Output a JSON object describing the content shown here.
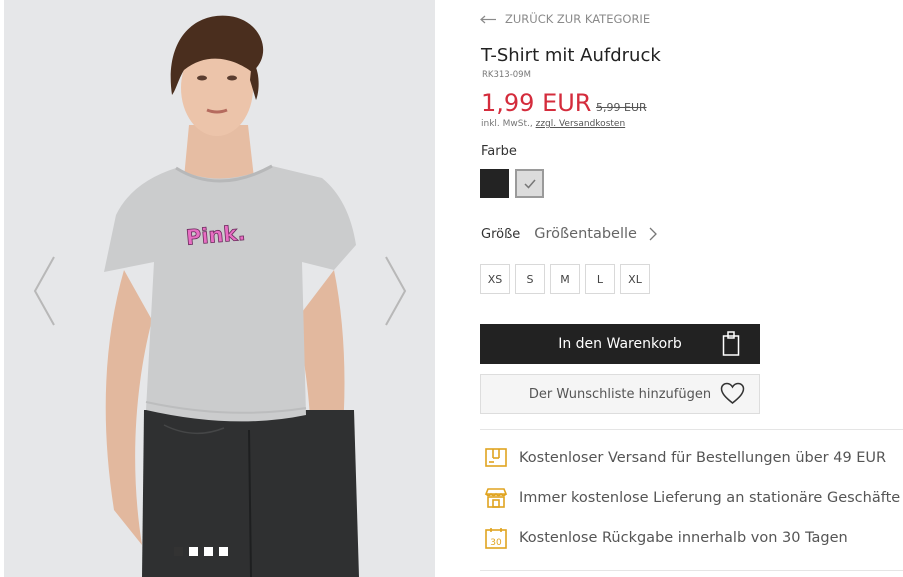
{
  "nav": {
    "back_label": "ZURÜCK ZUR KATEGORIE"
  },
  "product": {
    "title": "T-Shirt mit Aufdruck",
    "sku": "RK313-09M",
    "price": "1,99 EUR",
    "old_price": "5,99 EUR",
    "tax_prefix": "inkl. MwSt., ",
    "shipping_link": "zzgl. Versandkosten",
    "print_text": "Pink."
  },
  "color": {
    "label": "Farbe",
    "swatches": [
      {
        "name": "black",
        "hex": "#232323"
      },
      {
        "name": "light-grey",
        "hex": "#dcdcdc",
        "selected": true
      }
    ]
  },
  "size": {
    "label": "Größe",
    "chart_label": "Größentabelle",
    "options": [
      "XS",
      "S",
      "M",
      "L",
      "XL"
    ]
  },
  "actions": {
    "cart_label": "In den Warenkorb",
    "wishlist_label": "Der Wunschliste hinzufügen"
  },
  "benefits": [
    {
      "icon": "delivery-box-icon",
      "text": "Kostenloser Versand für Bestellungen über 49 EUR"
    },
    {
      "icon": "store-icon",
      "text": "Immer kostenlose Lieferung an stationäre Geschäfte"
    },
    {
      "icon": "calendar-30-icon",
      "text": "Kostenlose Rückgabe innerhalb von 30 Tagen"
    }
  ],
  "calendar_number": "30",
  "gallery": {
    "image_count": 4,
    "active_index": 0
  },
  "colors": {
    "price_red": "#d42c3c",
    "button_dark": "#222222",
    "icon_gold": "#e0a421"
  }
}
